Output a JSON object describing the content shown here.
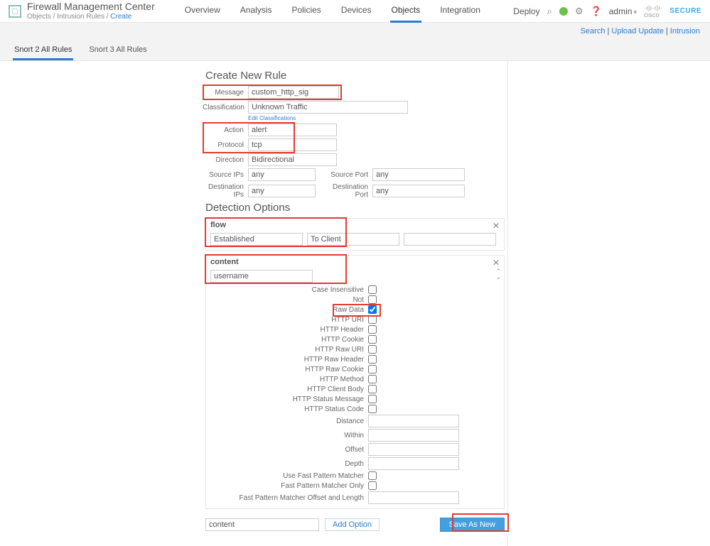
{
  "header": {
    "title": "Firewall Management Center",
    "crumb1": "Objects",
    "crumb2": "Intrusion Rules",
    "crumb3": "Create",
    "nav": [
      "Overview",
      "Analysis",
      "Policies",
      "Devices",
      "Objects",
      "Integration"
    ],
    "nav_active": 4,
    "deploy": "Deploy",
    "admin": "admin",
    "brand": "cisco",
    "secure": "SECURE"
  },
  "linkbar": {
    "search": "Search",
    "upload": "Upload Update",
    "intrusion": "Intrusion"
  },
  "tabs": {
    "t1": "Snort 2 All Rules",
    "t2": "Snort 3 All Rules"
  },
  "rule": {
    "section": "Create New Rule",
    "labels": {
      "message": "Message",
      "classification": "Classification",
      "edit_class": "Edit Classifications",
      "action": "Action",
      "protocol": "Protocol",
      "direction": "Direction",
      "src_ips": "Source IPs",
      "src_port": "Source Port",
      "dst_ips": "Destination IPs",
      "dst_port": "Destination Port"
    },
    "values": {
      "message": "custom_http_sig",
      "classification": "Unknown Traffic",
      "action": "alert",
      "protocol": "tcp",
      "direction": "Bidirectional",
      "src_ips": "any",
      "src_port": "any",
      "dst_ips": "any",
      "dst_port": "any"
    }
  },
  "detection": {
    "title": "Detection Options",
    "flow": {
      "head": "flow",
      "v1": "Established",
      "v2": "To Client"
    },
    "content": {
      "head": "content",
      "value": "username",
      "opts": {
        "case": "Case Insensitive",
        "not": "Not",
        "raw": "Raw Data",
        "uri": "HTTP URI",
        "header": "HTTP Header",
        "cookie": "HTTP Cookie",
        "rawuri": "HTTP Raw URI",
        "rawheader": "HTTP Raw Header",
        "rawcookie": "HTTP Raw Cookie",
        "method": "HTTP Method",
        "client": "HTTP Client Body",
        "status": "HTTP Status Message",
        "code": "HTTP Status Code",
        "distance": "Distance",
        "within": "Within",
        "offset": "Offset",
        "depth": "Depth",
        "fast": "Use Fast Pattern Matcher",
        "fastonly": "Fast Pattern Matcher Only",
        "fastoff": "Fast Pattern Matcher Offset and Length"
      },
      "checked": {
        "raw": true
      }
    },
    "bottom": {
      "sel": "content",
      "add": "Add Option",
      "save": "Save As New"
    }
  }
}
